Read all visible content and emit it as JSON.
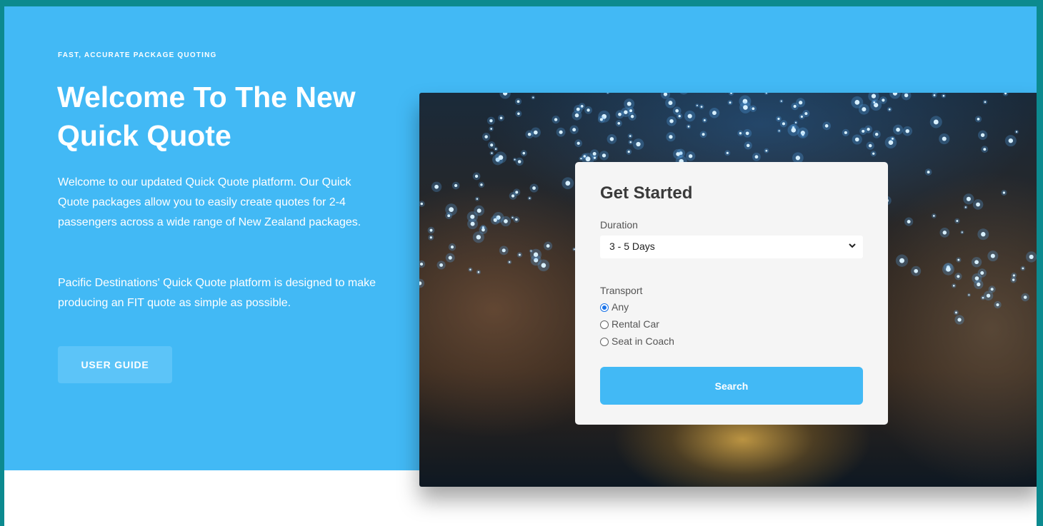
{
  "hero": {
    "eyebrow": "FAST, ACCURATE PACKAGE QUOTING",
    "title": "Welcome To The New Quick Quote",
    "paragraph1": "Welcome to our updated Quick Quote platform. Our Quick Quote packages allow you to easily create quotes for 2-4 passengers across a wide range of New Zealand packages.",
    "paragraph2": "Pacific Destinations' Quick Quote platform is designed to make producing an FIT quote as simple as possible.",
    "user_guide_button": "USER GUIDE"
  },
  "form": {
    "title": "Get Started",
    "duration_label": "Duration",
    "duration_selected": "3 - 5 Days",
    "transport_label": "Transport",
    "transport_options": [
      {
        "label": "Any",
        "selected": true
      },
      {
        "label": "Rental Car",
        "selected": false
      },
      {
        "label": "Seat in Coach",
        "selected": false
      }
    ],
    "search_button": "Search"
  },
  "colors": {
    "page_border": "#0c8a8f",
    "hero_background": "#42b9f5",
    "user_guide_button": "#5cc4f8",
    "search_button": "#42b9f5",
    "card_background": "#f5f5f5"
  },
  "image": {
    "subject": "glowworm-cave-photo"
  }
}
